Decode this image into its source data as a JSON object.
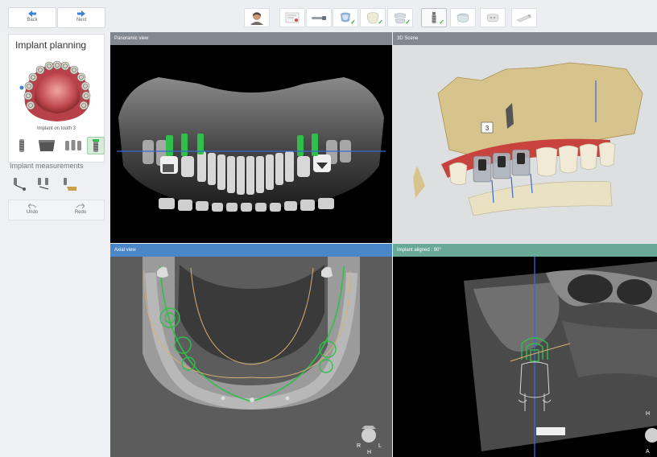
{
  "nav": {
    "back_label": "Back",
    "next_label": "Next"
  },
  "workflow": {
    "steps": [
      {
        "icon": "patient-icon",
        "checked": false
      },
      {
        "icon": "prescription-icon",
        "checked": false
      },
      {
        "icon": "scan-icon",
        "checked": false
      },
      {
        "icon": "cbct-import-icon",
        "checked": true
      },
      {
        "icon": "tooth-icon",
        "checked": true
      },
      {
        "icon": "jaw-alignment-icon",
        "checked": true
      },
      {
        "icon": "implant-icon",
        "checked": true
      },
      {
        "icon": "sleeve-icon",
        "checked": false
      },
      {
        "icon": "guide-icon",
        "checked": false
      },
      {
        "icon": "export-icon",
        "checked": false
      }
    ],
    "active_index": 6,
    "check_glyph": "✓"
  },
  "sidebar": {
    "panel_title": "Implant planning",
    "panel_caption": "Implant on tooth 3",
    "implant_tools": [
      {
        "icon": "single-implant-icon",
        "active": false
      },
      {
        "icon": "abutment-icon",
        "active": false
      },
      {
        "icon": "multiple-implants-icon",
        "active": false
      },
      {
        "icon": "implant-library-icon",
        "active": true
      }
    ],
    "measurements_label": "Implant measurements",
    "measurement_tools": [
      {
        "icon": "distance-measure-icon"
      },
      {
        "icon": "implant-distance-icon"
      },
      {
        "icon": "bone-density-icon"
      }
    ],
    "undo_label": "Undo",
    "redo_label": "Redo"
  },
  "views": {
    "panoramic": {
      "title": "Panoramic view",
      "header_color": "#828890"
    },
    "scene3d": {
      "title": "3D Scene",
      "header_color": "#828890"
    },
    "axial": {
      "title": "Axial view",
      "header_color": "#4a86c8"
    },
    "aligned": {
      "title": "Implant aligned : 90°",
      "header_color": "#6aa996"
    }
  },
  "scene_label": "3",
  "orientation": {
    "axial": {
      "left": "R",
      "right": "L",
      "bottom": "H"
    },
    "aligned": {
      "top": "H",
      "bottom": "A"
    }
  },
  "colors": {
    "implant_green": "#2fbf4a",
    "plane_blue": "#3a66d8",
    "arch_gold": "#d8b070",
    "gingiva": "#c8433e"
  }
}
